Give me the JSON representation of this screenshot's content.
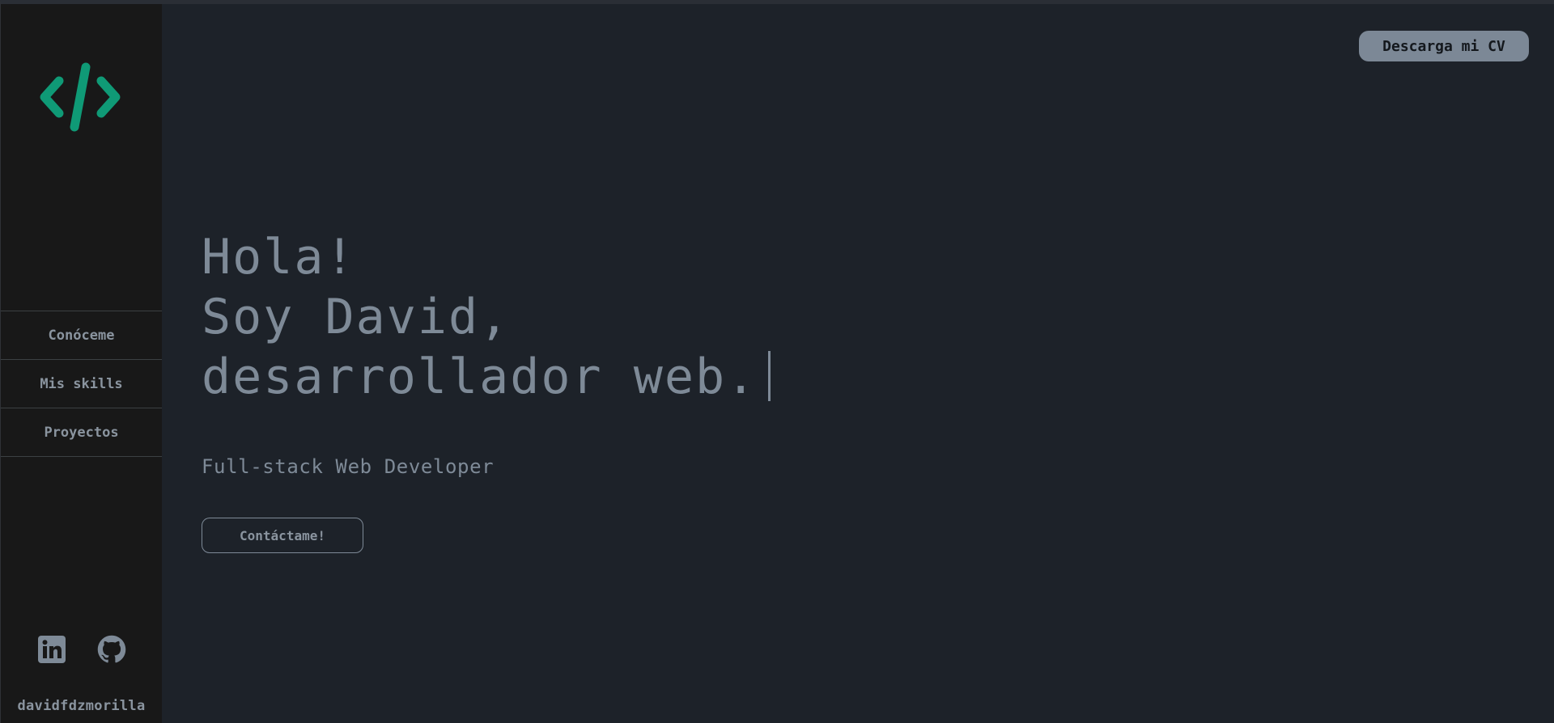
{
  "colors": {
    "background": "#1d2229",
    "sidebar": "#181818",
    "accent": "#0f9a76",
    "text": "#7e8a97"
  },
  "sidebar": {
    "logo_icon": "code-brackets-icon",
    "nav": [
      {
        "label": "Conóceme"
      },
      {
        "label": "Mis skills"
      },
      {
        "label": "Proyectos"
      }
    ],
    "social": [
      {
        "icon": "linkedin-icon"
      },
      {
        "icon": "github-icon"
      }
    ],
    "handle": "davidfdzmorilla"
  },
  "header": {
    "cv_button_label": "Descarga mi CV"
  },
  "hero": {
    "line1": "Hola!",
    "line2": "Soy David,",
    "line3": "desarrollador web.",
    "subtitle": "Full-stack Web Developer",
    "contact_label": "Contáctame!"
  }
}
